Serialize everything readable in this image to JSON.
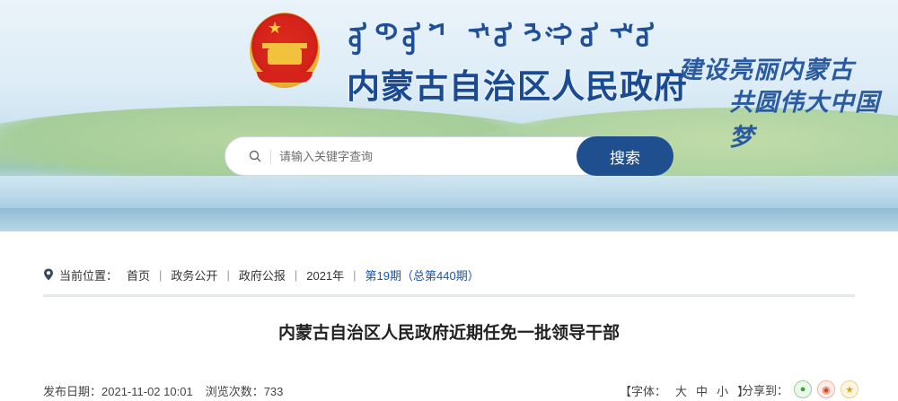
{
  "header": {
    "mongolian_script": "ᠥᠪᠦᠷ ᠮᠣᠩᠭᠣᠯ ᠤᠨ ᠥᠪᠡᠷᠲᠡᠭᠡᠨ ᠵᠠᠰᠠᠬᠤ ᠣᠷᠣᠨ ᠤ ᠠᠷᠠᠳ ᠤᠨ ᠵᠠᠰᠠᠭ ᠤᠨ ᠭᠠᠵᠠᠷ",
    "site_title": "内蒙古自治区人民政府",
    "slogan_line1": "建设亮丽内蒙古",
    "slogan_line2": "共圆伟大中国梦"
  },
  "search": {
    "placeholder": "请输入关键字查询",
    "button_label": "搜索"
  },
  "breadcrumb": {
    "label": "当前位置：",
    "items": [
      "首页",
      "政务公开",
      "政府公报",
      "2021年"
    ],
    "current": "第19期（总第440期）"
  },
  "article": {
    "title": "内蒙古自治区人民政府近期任免一批领导干部",
    "publish_date": "发布日期：2021-11-02 10:01",
    "views": "浏览次数：733"
  },
  "font_size": {
    "label": "【字体：",
    "large": "大",
    "medium": "中",
    "small": "小",
    "close": "】"
  },
  "share": {
    "label": "分享到：",
    "icons": [
      "wechat-icon",
      "weibo-icon",
      "favorite-icon"
    ]
  },
  "colors": {
    "brand_blue": "#1a4a93",
    "button_blue": "#1f4f8f",
    "current_link": "#1a56b0"
  }
}
